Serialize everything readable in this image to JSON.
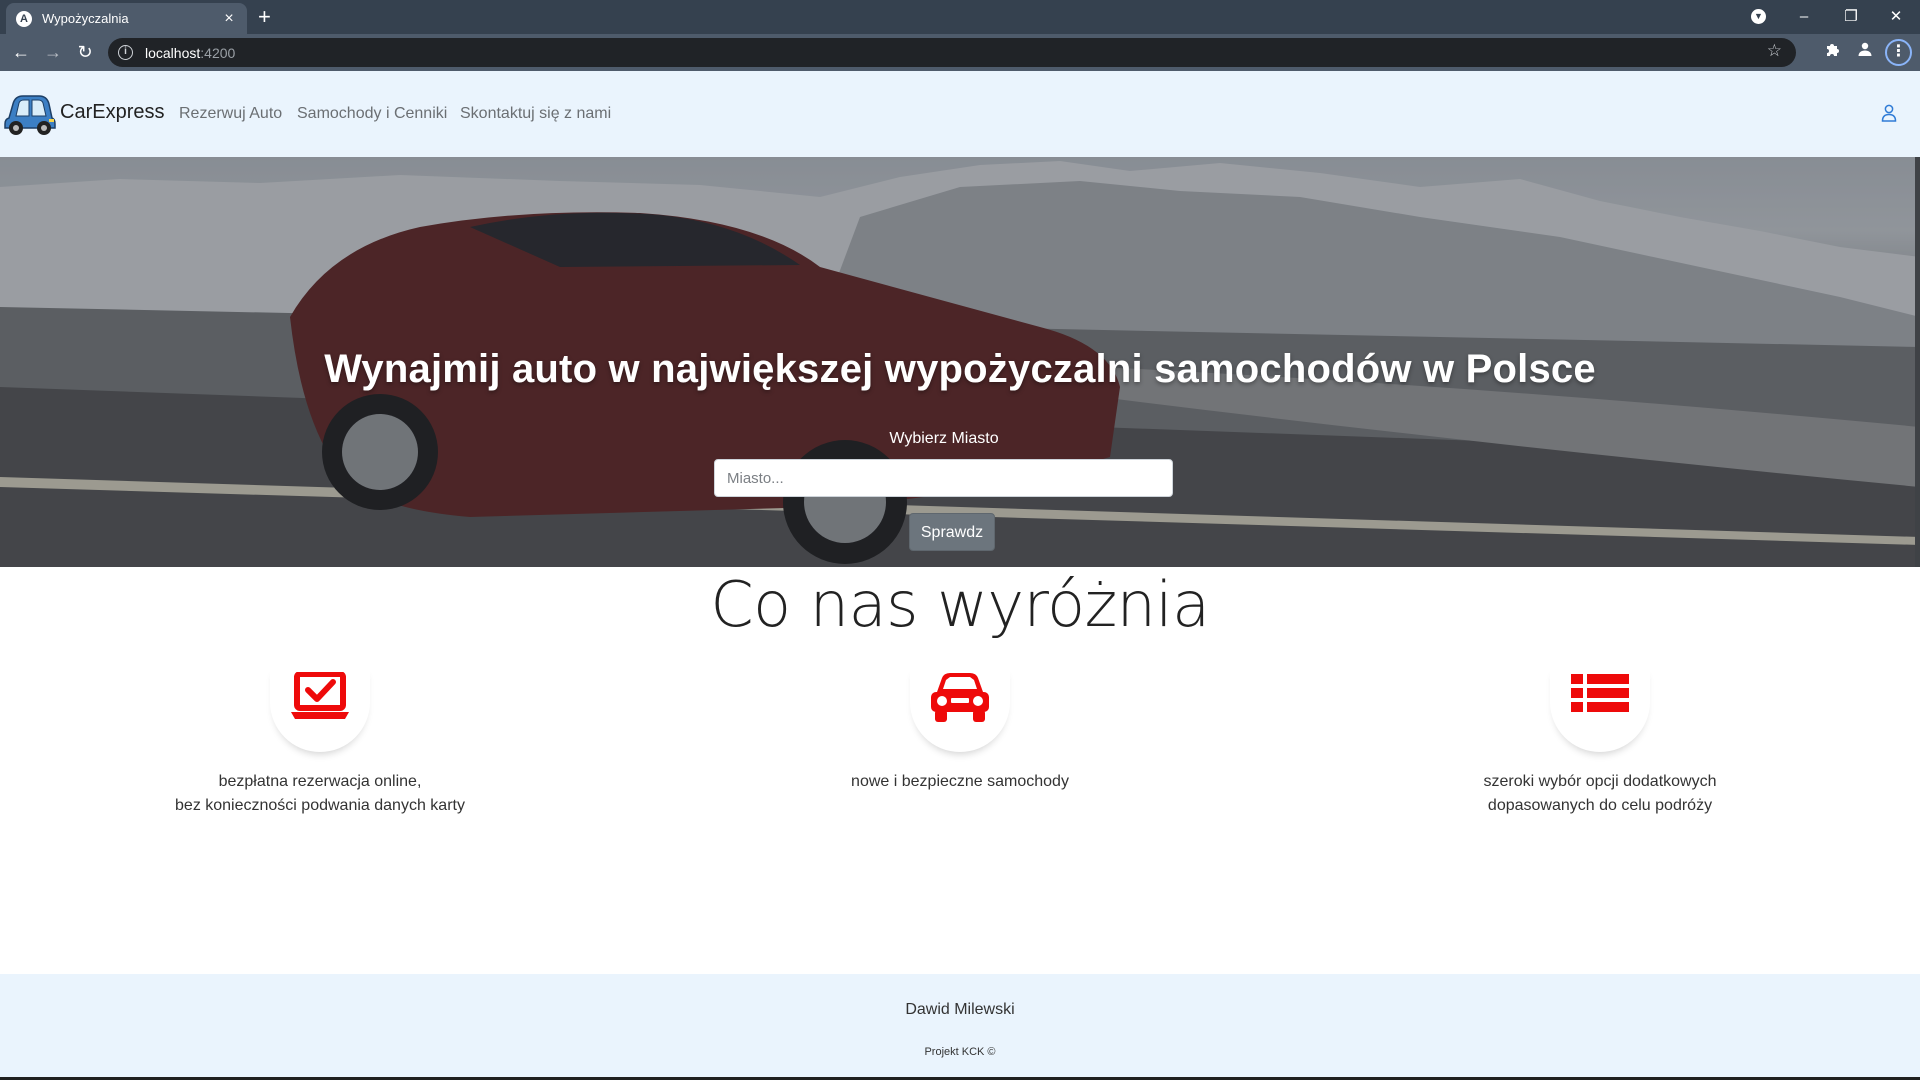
{
  "browser": {
    "tab_title": "Wypożyczalnia",
    "tab_favicon": "A",
    "url_host": "localhost",
    "url_port": ":4200"
  },
  "navbar": {
    "brand": "CarExpress",
    "links": [
      "Rezerwuj Auto",
      "Samochody i Cenniki",
      "Skontaktuj się z nami"
    ]
  },
  "hero": {
    "title": "Wynajmij auto w największej wypożyczalni samochodów w Polsce",
    "city_label": "Wybierz Miasto",
    "city_placeholder": "Miasto...",
    "button": "Sprawdz"
  },
  "features": {
    "title": "Co nas wyróżnia",
    "items": [
      {
        "icon": "laptop-check-icon",
        "line1": "bezpłatna rezerwacja online,",
        "line2": "bez konieczności podwania danych karty"
      },
      {
        "icon": "car-icon",
        "line1": "nowe i bezpieczne samochody",
        "line2": ""
      },
      {
        "icon": "list-icon",
        "line1": "szeroki wybór opcji dodatkowych",
        "line2": "dopasowanych do celu podróży"
      }
    ],
    "icon_color": "#ee0a0a"
  },
  "footer": {
    "author": "Dawid Milewski",
    "project": "Projekt KCK ©"
  }
}
